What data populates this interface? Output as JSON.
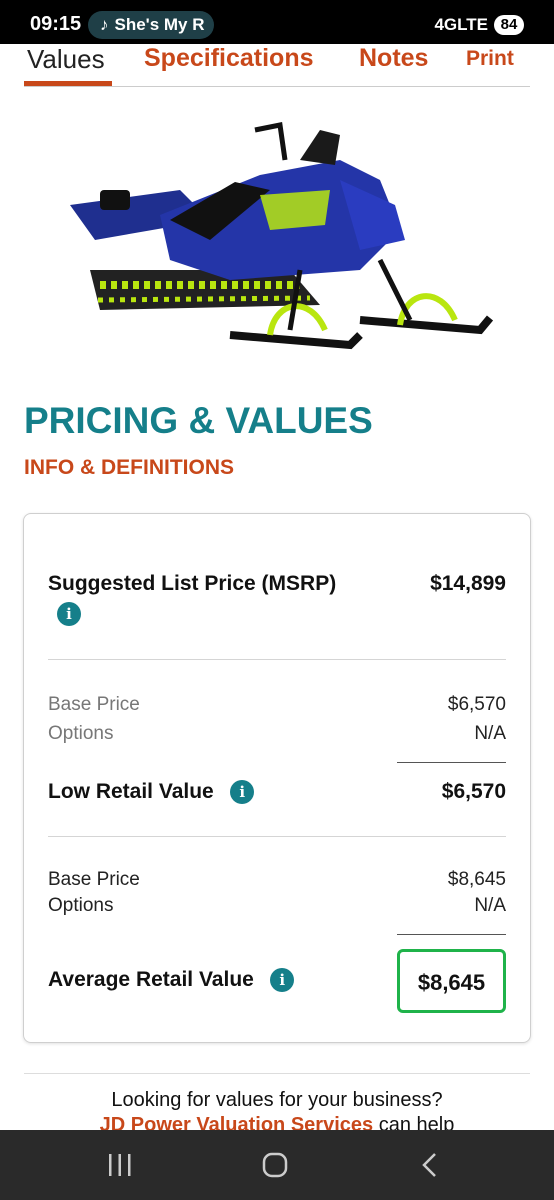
{
  "status_bar": {
    "time": "09:15",
    "now_playing": "She's My R",
    "network": "4GLTE",
    "battery": "84"
  },
  "tabs": [
    {
      "label": "Values",
      "active": true
    },
    {
      "label": "Specifications",
      "active": false
    },
    {
      "label": "Notes",
      "active": false
    },
    {
      "label": "Print",
      "active": false
    }
  ],
  "headings": {
    "pricing": "PRICING & VALUES",
    "info": "INFO & DEFINITIONS"
  },
  "pricing": {
    "msrp": {
      "label": "Suggested List Price (MSRP)",
      "value": "$14,899"
    },
    "low": {
      "base_label": "Base Price",
      "base_value": "$6,570",
      "options_label": "Options",
      "options_value": "N/A",
      "label": "Low Retail Value",
      "value": "$6,570"
    },
    "average": {
      "base_label": "Base Price",
      "base_value": "$8,645",
      "options_label": "Options",
      "options_value": "N/A",
      "label": "Average Retail Value",
      "value": "$8,645"
    }
  },
  "promo": {
    "line1": "Looking for values for your business?",
    "link": "JD Power Valuation Services",
    "line2_rest": " can help"
  },
  "colors": {
    "accent_orange": "#c8481a",
    "teal": "#157f8a",
    "highlight_green": "#1fb34a"
  }
}
